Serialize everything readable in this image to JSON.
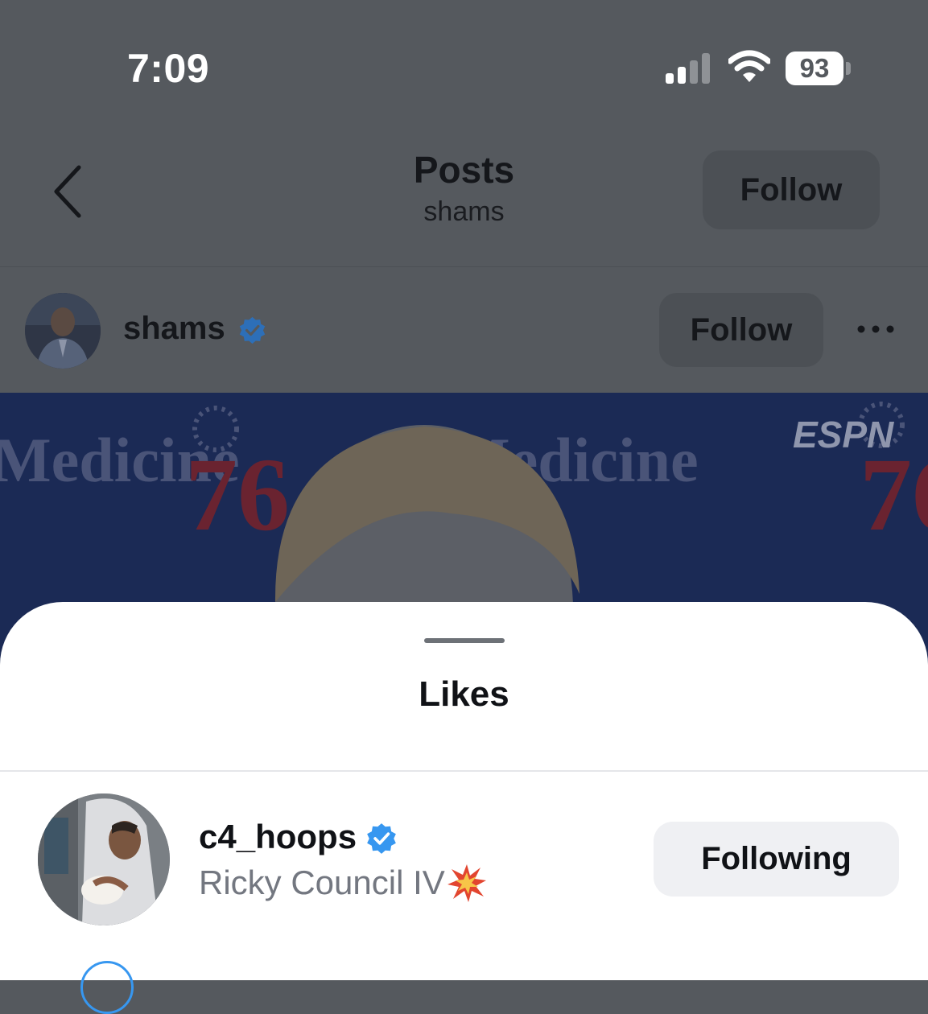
{
  "status_bar": {
    "time": "7:09",
    "battery": "93",
    "signal_bars_active": 2,
    "signal_bars_total": 4,
    "icons": [
      "cellular-signal-icon",
      "wifi-icon",
      "battery-icon"
    ]
  },
  "nav": {
    "title": "Posts",
    "subtitle": "shams",
    "follow_label": "Follow",
    "back_icon": "chevron-left-icon"
  },
  "post": {
    "username": "shams",
    "verified": true,
    "follow_label": "Follow",
    "more_icon": "more-horizontal-icon",
    "image_texts": [
      "ESPN",
      "76",
      "Medicine"
    ]
  },
  "likes_sheet": {
    "title": "Likes",
    "users": [
      {
        "username": "c4_hoops",
        "verified": true,
        "full_name": "Ricky Council IV",
        "emoji": "collision-icon",
        "button_label": "Following"
      }
    ]
  },
  "colors": {
    "verified": "#3797f0",
    "overlay": "#55595e",
    "sheet": "#ffffff",
    "secondary_text": "#737780",
    "button_bg": "#eff0f3"
  }
}
